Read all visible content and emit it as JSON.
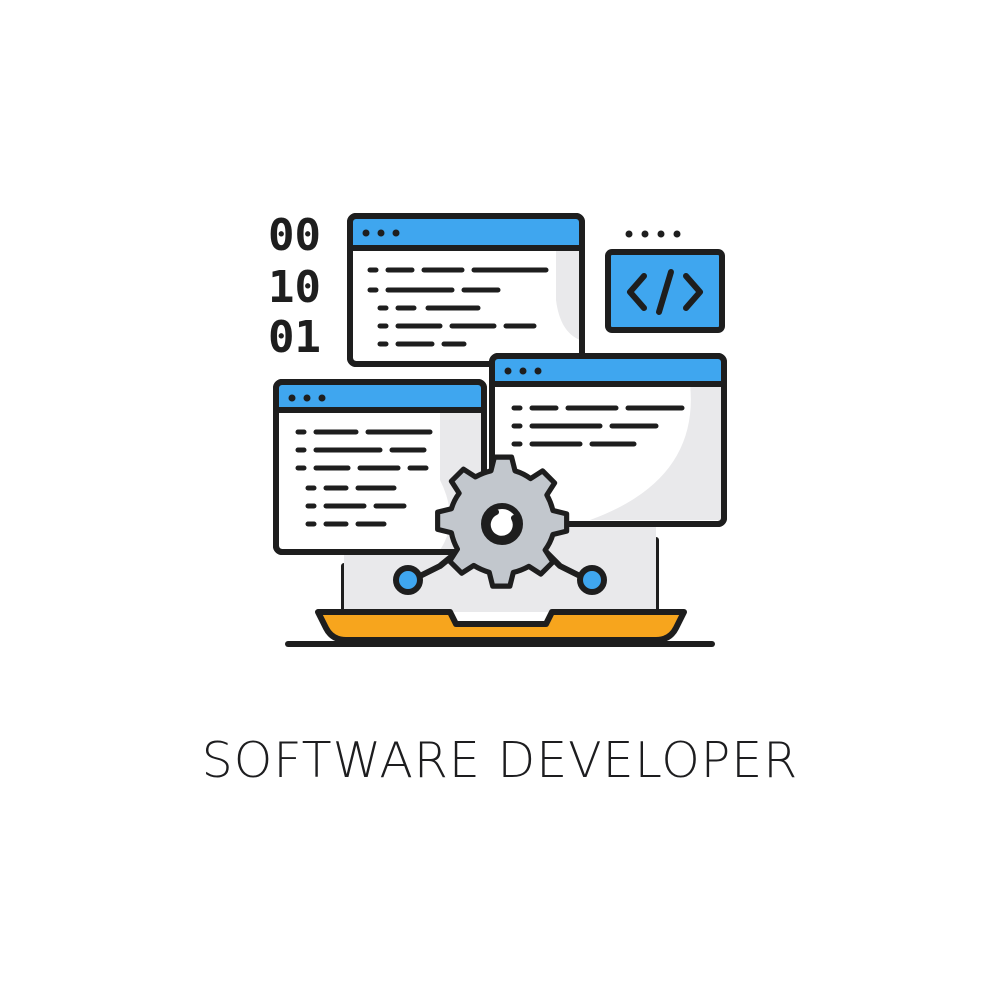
{
  "caption": "SOFTWARE DEVELOPER",
  "binary_digits": [
    "00",
    "10",
    "01"
  ],
  "code_tag_icon": "code-brackets-icon",
  "colors": {
    "outline": "#1e1e1e",
    "accent_blue": "#3fa6ef",
    "accent_orange": "#f7a51d",
    "panel_shade": "#e9e9eb",
    "gear_gray": "#c2c7cd"
  }
}
